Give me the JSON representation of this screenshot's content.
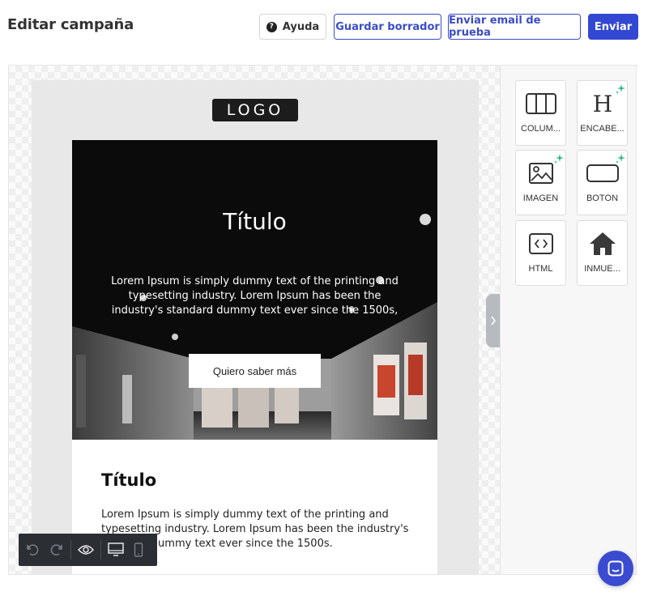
{
  "header": {
    "title": "Editar campaña",
    "help_label": "Ayuda",
    "save_draft_label": "Guardar borrador",
    "send_test_label": "Enviar email de prueba",
    "send_label": "Enviar"
  },
  "email": {
    "logo_text": "LOGO",
    "hero": {
      "title": "Título",
      "text": "Lorem Ipsum is simply dummy text of the printing and typesetting industry. Lorem Ipsum has been the industry's standard dummy text ever since the 1500s,",
      "button_label": "Quiero saber más"
    },
    "content": {
      "title": "Título",
      "text": "Lorem Ipsum is simply dummy text of the printing and typesetting industry. Lorem Ipsum has been the industry's standard dummy text ever since the 1500s."
    }
  },
  "sidebar": {
    "blocks": [
      {
        "label": "COLUM...",
        "icon": "columns-icon"
      },
      {
        "label": "ENCABE...",
        "icon": "heading-icon"
      },
      {
        "label": "IMAGEN",
        "icon": "image-icon"
      },
      {
        "label": "BOTÓN",
        "icon": "button-icon"
      },
      {
        "label": "HTML",
        "icon": "code-icon"
      },
      {
        "label": "INMUE...",
        "icon": "house-icon"
      }
    ]
  },
  "colors": {
    "primary": "#3348d2",
    "sparkle": "#2bb58a",
    "toolbar": "#2b2e33"
  }
}
